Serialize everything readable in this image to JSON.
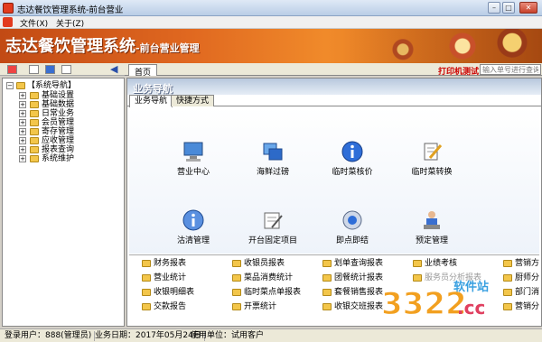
{
  "window": {
    "title": "志达餐饮管理系统-前台营业",
    "min": "–",
    "max": "□",
    "close": "✕"
  },
  "menu": {
    "items": [
      {
        "label": "文件(X)"
      },
      {
        "label": "关于(Z)"
      }
    ]
  },
  "banner": {
    "brand": "志达餐饮管理系统",
    "subtitle": "-前台营业管理"
  },
  "toolbar": {
    "home_tab": "首页",
    "print_test": "打印机测试",
    "search_placeholder": "输入单号进行查询"
  },
  "tree": {
    "root": "【系统导航】",
    "items": [
      {
        "label": "基础设置"
      },
      {
        "label": "基础数据"
      },
      {
        "label": "日常业务"
      },
      {
        "label": "会员管理"
      },
      {
        "label": "寄存管理"
      },
      {
        "label": "应收管理"
      },
      {
        "label": "报表查询"
      },
      {
        "label": "系统维护"
      }
    ]
  },
  "main": {
    "header": "业务导航",
    "tabs": [
      {
        "label": "业务导航"
      },
      {
        "label": "快捷方式"
      }
    ],
    "nav": [
      {
        "label": "营业中心"
      },
      {
        "label": "海鲜过磅"
      },
      {
        "label": "临时菜核价"
      },
      {
        "label": "临时菜转换"
      },
      {
        "label": "沽清管理"
      },
      {
        "label": "开台固定项目"
      },
      {
        "label": "即点即结"
      },
      {
        "label": "预定管理"
      }
    ],
    "reports": [
      {
        "label": "财务报表"
      },
      {
        "label": "收银员报表"
      },
      {
        "label": "划单查询报表"
      },
      {
        "label": "业绩考核"
      },
      {
        "label": "营销方"
      },
      {
        "label": "营业统计"
      },
      {
        "label": "菜品消费统计"
      },
      {
        "label": "团餐统计报表"
      },
      {
        "label": "服务员分析报表"
      },
      {
        "label": "厨师分"
      },
      {
        "label": "收银明细表"
      },
      {
        "label": "临时菜点单报表"
      },
      {
        "label": "套餐销售报表"
      },
      {
        "label": ""
      },
      {
        "label": "部门消"
      },
      {
        "label": "交款报告"
      },
      {
        "label": "开票统计"
      },
      {
        "label": "收银交班报表"
      },
      {
        "label": ""
      },
      {
        "label": "营销分"
      }
    ]
  },
  "status": {
    "user": "登录用户：888(管理员)",
    "date": "业务日期：2017年05月24日",
    "unit": "使用单位：试用客户"
  },
  "watermark": {
    "text": "3322",
    "site": "软件站",
    "domain": ".cc"
  }
}
